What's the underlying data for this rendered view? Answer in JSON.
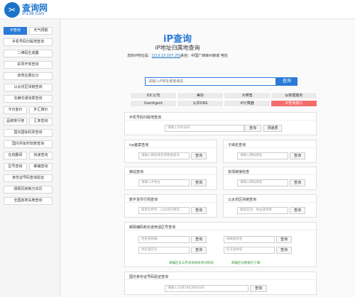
{
  "header": {
    "logo_icon": "tools-icon",
    "logo_glyph": "✂",
    "site_name": "查询网",
    "site_domain": "iP138.com"
  },
  "sidebar": {
    "items": [
      "iP查询",
      "天气预报",
      "手机号码归属地查询",
      "二维码生成器",
      "彩票开奖查询",
      "体育比赛比分",
      "以太坊区块链查询",
      "车辆交通违章查询",
      "今日金价",
      "外汇牌价",
      "品牌排行榜",
      "汇率查询",
      "国内国际机票查询",
      "国内列车时刻表查询",
      "在线翻译",
      "快递查询",
      "区号查询",
      "邮编查询",
      "身份证号码查询验证",
      "阴阳历转换万年历",
      "全国各地车牌查询"
    ]
  },
  "main": {
    "title": "iP查询",
    "subtitle": "iP地址归属地查询",
    "ip_label": "您的iP地址是：",
    "ip_value": "[113.13.107.25]",
    "ip_location": "来自：中国广西柳州柳城 电信",
    "search_placeholder": "请输入iP地址或者域名",
    "search_button": "查询",
    "tabs_row1": [
      "iDC公司",
      "美协",
      "大带宽",
      "Ip数据服务"
    ],
    "tabs_row2": [
      "UserAgent",
      "公共DNS",
      "iP计算器",
      "iP查询接口"
    ]
  },
  "panels": {
    "mobile": {
      "title": "手机号码归属地查询",
      "placeholder": "请输入手机号码",
      "query": "查询",
      "speed": "测速费"
    },
    "icp": {
      "title": "icp备案查询",
      "placeholder": "请输入网站域名或者备案号",
      "query": "查询"
    },
    "subdomain": {
      "title": "子域名查询",
      "placeholder": "请输入网站域名",
      "query": "查询"
    },
    "station": {
      "title": "旁站查询",
      "placeholder": "请输入iP地址",
      "query": "查询"
    },
    "friend": {
      "title": "友情链接检查",
      "placeholder": "请输入网站域名",
      "query": "查询"
    },
    "crypto": {
      "title": "数字货币行情查询",
      "placeholder": "搜索比特币、以太坊行情等...",
      "query": "查询"
    },
    "eth": {
      "title": "以太坊区块链查询",
      "placeholder": "搜索区块、地址或哈希",
      "query": "查询"
    },
    "postal": {
      "title": "邮政编码和长途电话区号查询",
      "p1": "地名查邮编",
      "p2": "邮编查地名",
      "p3": "地名查区号",
      "p4": "区号查地名",
      "query": "查询",
      "link1": "邮编区号与市县地域关系对照表",
      "link2": "邮编区号数据包下载"
    },
    "idcard": {
      "title": "国内身份证号码验证查询",
      "placeholder": "请输入15或18位身份证号",
      "query": "查询"
    }
  }
}
